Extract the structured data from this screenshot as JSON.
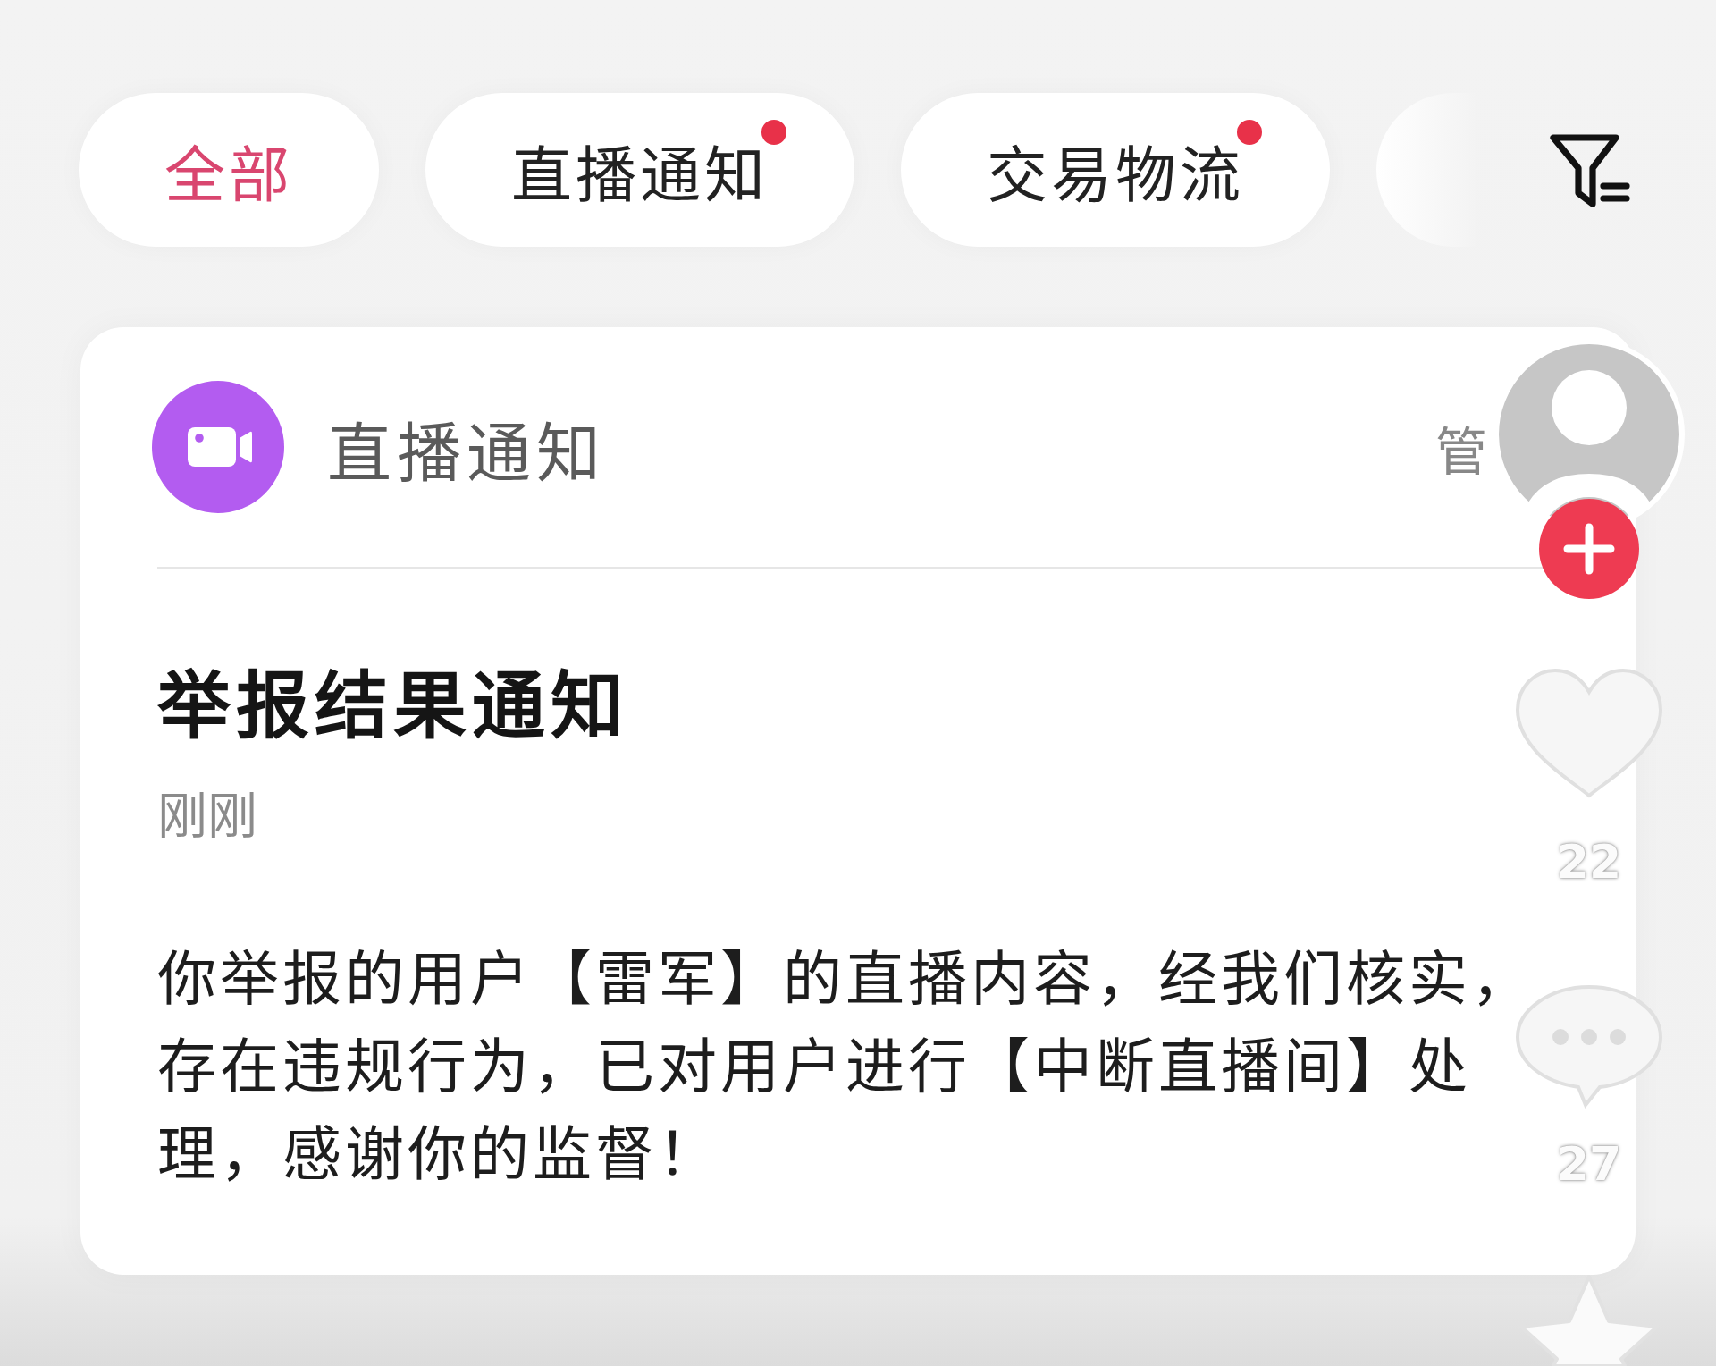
{
  "tabs": [
    {
      "label": "全部",
      "selected": true,
      "unread": false
    },
    {
      "label": "直播通知",
      "selected": false,
      "unread": true
    },
    {
      "label": "交易物流",
      "selected": false,
      "unread": true
    }
  ],
  "notification_card": {
    "category": "直播通知",
    "manage_label": "管",
    "title": "举报结果通知",
    "time": "刚刚",
    "body": "你举报的用户【雷军】的直播内容，经我们核实，存在违规行为，已对用户进行【中断直播间】处理，感谢你的监督！"
  },
  "side_rail": {
    "like_count": "22",
    "comment_count": "27"
  }
}
